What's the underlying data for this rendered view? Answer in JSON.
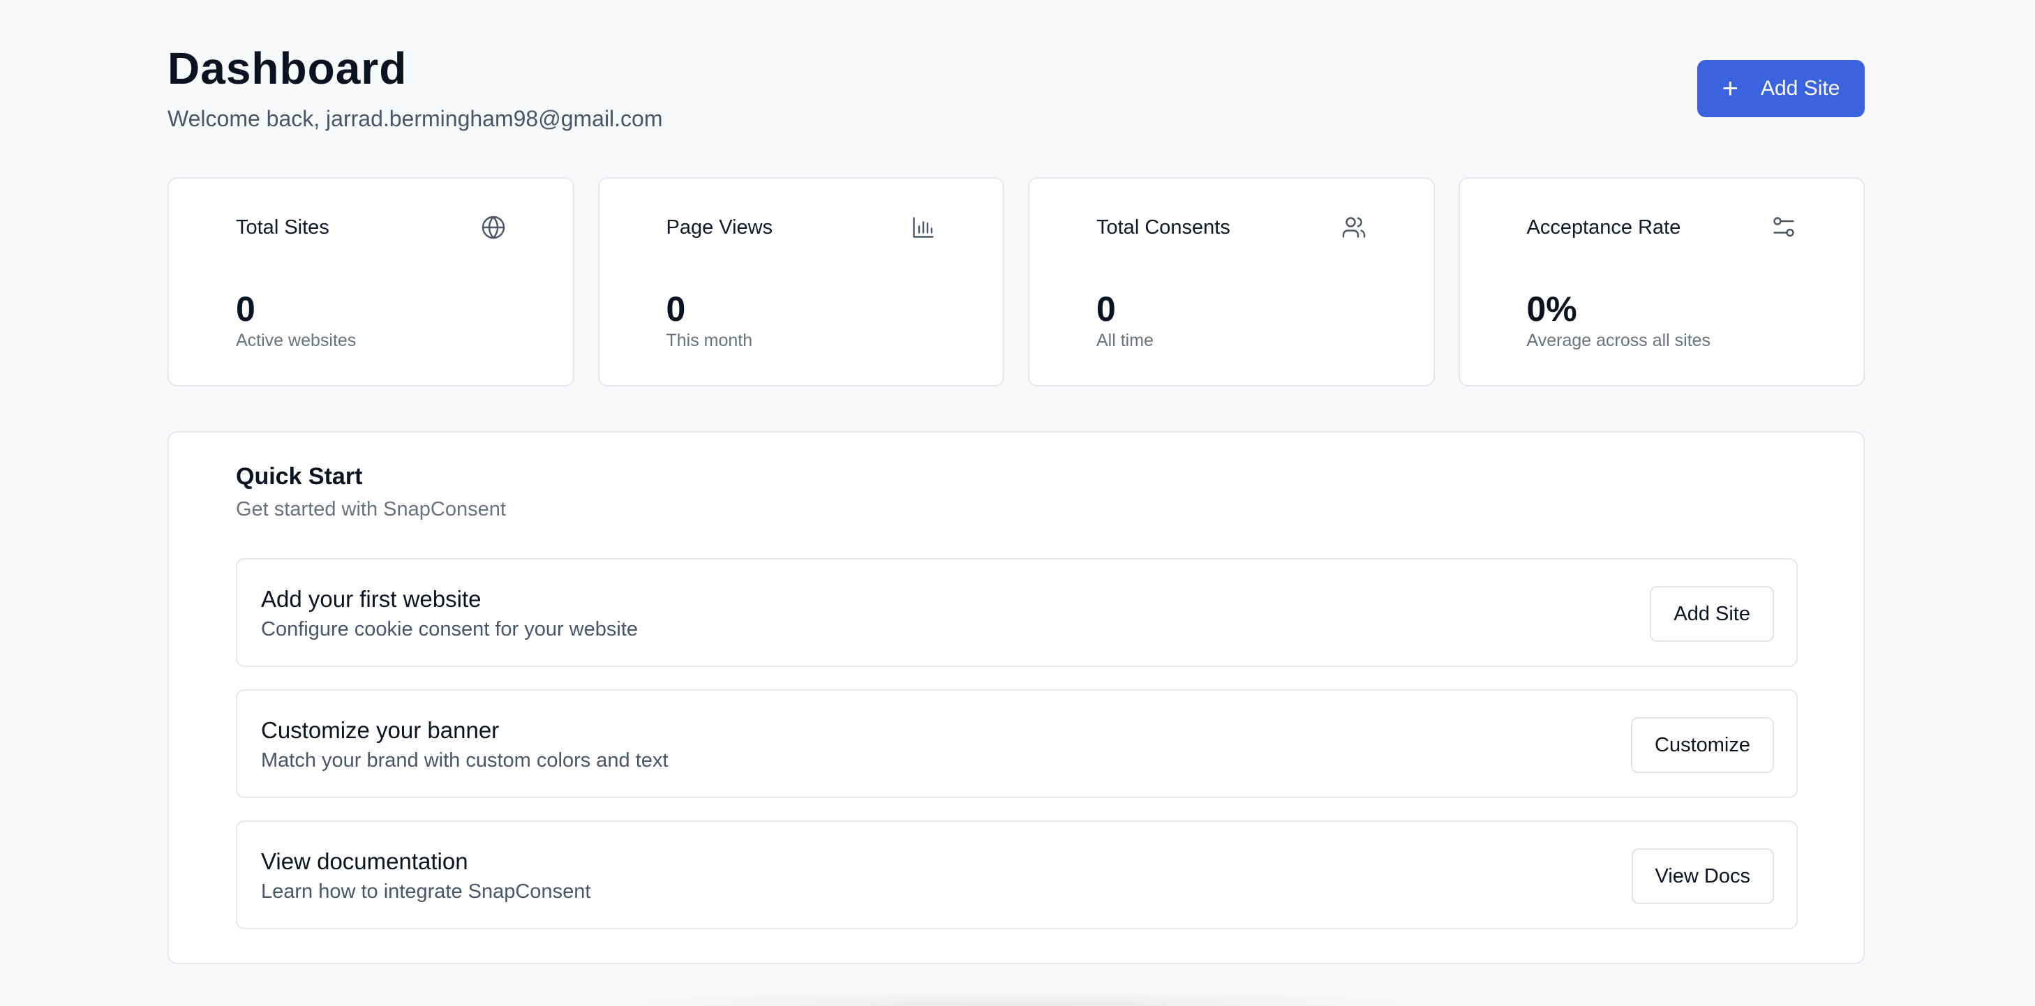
{
  "header": {
    "title": "Dashboard",
    "subtitle": "Welcome back, jarrad.bermingham98@gmail.com",
    "add_button_label": "Add Site",
    "add_button_icon": "plus-icon"
  },
  "stats": [
    {
      "label": "Total Sites",
      "icon": "globe-icon",
      "value": "0",
      "caption": "Active websites"
    },
    {
      "label": "Page Views",
      "icon": "bar-chart-icon",
      "value": "0",
      "caption": "This month"
    },
    {
      "label": "Total Consents",
      "icon": "users-icon",
      "value": "0",
      "caption": "All time"
    },
    {
      "label": "Acceptance Rate",
      "icon": "sliders-icon",
      "value": "0%",
      "caption": "Average across all sites"
    }
  ],
  "quick_start": {
    "title": "Quick Start",
    "subtitle": "Get started with SnapConsent",
    "tasks": [
      {
        "title": "Add your first website",
        "description": "Configure cookie consent for your website",
        "button": "Add Site"
      },
      {
        "title": "Customize your banner",
        "description": "Match your brand with custom colors and text",
        "button": "Customize"
      },
      {
        "title": "View documentation",
        "description": "Learn how to integrate SnapConsent",
        "button": "View Docs"
      }
    ]
  },
  "colors": {
    "primary": "#3b63e0",
    "background": "#f8f9fb",
    "card": "#ffffff",
    "border": "#e5e8ee",
    "muted_text": "#6b7280"
  }
}
